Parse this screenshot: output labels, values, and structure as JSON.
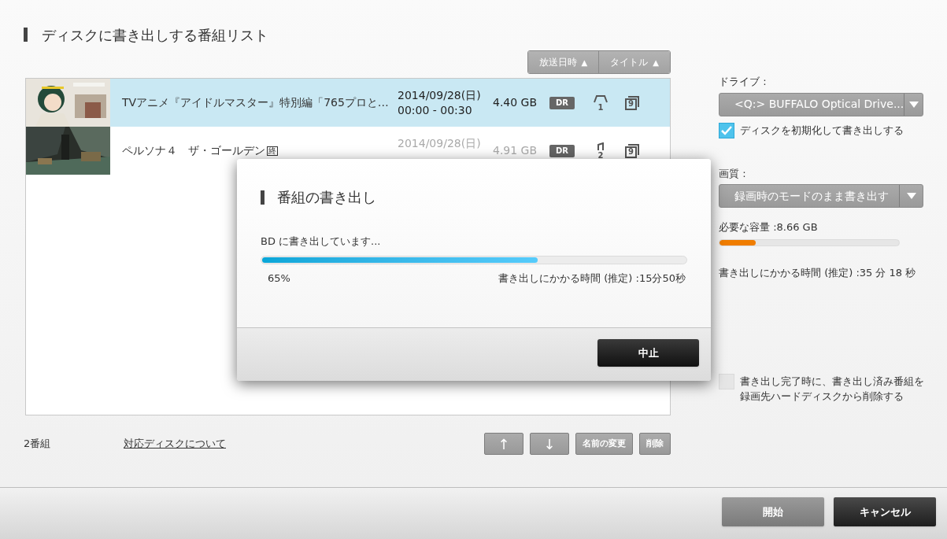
{
  "title": "ディスクに書き出しする番組リスト",
  "sort_buttons": [
    {
      "label": "放送日時",
      "arrow": "▲"
    },
    {
      "label": "タイトル",
      "arrow": "▲"
    }
  ],
  "programs": [
    {
      "selected": true,
      "title": "TVアニメ『アイドルマスター』特別編「765プロと…",
      "date": "2014/09/28(日)",
      "time": "00:00 - 00:30",
      "size": "4.40 GB",
      "mode": "DR",
      "disc_number": "1",
      "copy_count": "9"
    },
    {
      "selected": false,
      "title": "ペルソナ４　ザ・ゴールデン",
      "end_mark": "終",
      "date": "2014/09/28(日)",
      "size": "4.91 GB",
      "mode": "DR",
      "disc_number": "2",
      "copy_count": "9"
    }
  ],
  "count": "2番組",
  "link": "対応ディスクについて",
  "list_buttons": [
    {
      "kind": "arrow",
      "label": "↑"
    },
    {
      "kind": "arrow",
      "label": "↓"
    },
    {
      "kind": "text",
      "label": "名前の変更"
    },
    {
      "kind": "text",
      "label": "削除"
    }
  ],
  "drive": {
    "label": "ドライブ :",
    "value": "<Q:> BUFFALO Optical Drive..."
  },
  "format_option": {
    "label": "ディスクを初期化して書き出しする",
    "checked": true
  },
  "quality": {
    "label": "画質 :",
    "value": "録画時のモードのまま書き出す"
  },
  "capacity": {
    "label": "必要な容量 :8.66 GB",
    "level": 0.2
  },
  "total_time": "書き出しにかかる時間 (推定) :35 分 18 秒",
  "delete_option": {
    "label": "書き出し完了時に、書き出し済み番組を録画先ハードディスクから削除する",
    "checked": false
  },
  "footer_buttons": [
    "開始",
    "キャンセル"
  ],
  "dialog": {
    "title": "番組の書き出し",
    "message": "BD に書き出しています...",
    "progress": {
      "level": 0.65
    },
    "percent": "65%",
    "remaining": "書き出しにかかる時間 (推定) :15分50秒",
    "button": "中止"
  }
}
